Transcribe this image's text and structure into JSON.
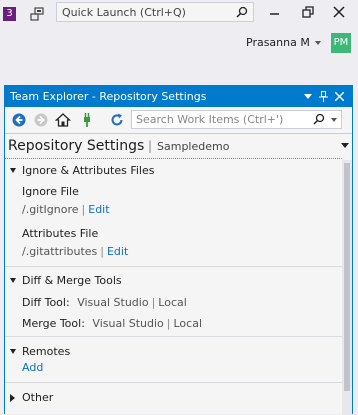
{
  "topbar": {
    "badge": "3",
    "quick_launch_placeholder": "Quick Launch (Ctrl+Q)",
    "user_name": "Prasanna M",
    "avatar_initials": "PM"
  },
  "panel": {
    "title": "Team Explorer - Repository Settings",
    "search_placeholder": "Search Work Items (Ctrl+')",
    "header_title": "Repository Settings",
    "header_separator": "|",
    "header_repo": "Sampledemo"
  },
  "sections": {
    "ignore": {
      "title": "Ignore & Attributes Files",
      "ignore_label": "Ignore File",
      "ignore_path": "/.gitIgnore",
      "attributes_label": "Attributes File",
      "attributes_path": "/.gitattributes",
      "edit_label": "Edit",
      "pipe": "|"
    },
    "diff": {
      "title": "Diff & Merge Tools",
      "diff_label": "Diff Tool:",
      "merge_label": "Merge Tool:",
      "tool_value": "Visual Studio",
      "local_label": "Local",
      "pipe": "|"
    },
    "remotes": {
      "title": "Remotes",
      "add_label": "Add"
    },
    "other": {
      "title": "Other"
    }
  },
  "colors": {
    "accent": "#007acc",
    "link": "#0e70c0",
    "badge": "#68217a",
    "avatar": "#3cb878"
  }
}
